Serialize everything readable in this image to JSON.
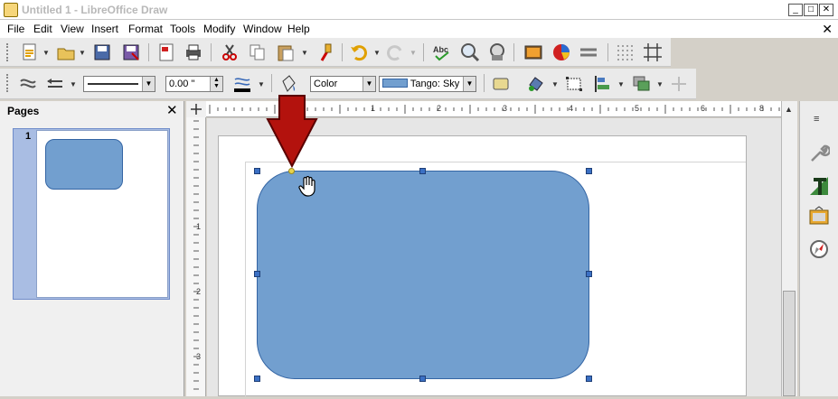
{
  "window": {
    "title": "Untitled 1 - LibreOffice Draw",
    "minimize": "_",
    "maximize": "□",
    "close": "✕",
    "doc_close": "✕"
  },
  "menu": [
    "File",
    "Edit",
    "View",
    "Insert",
    "Format",
    "Tools",
    "Modify",
    "Window",
    "Help"
  ],
  "toolbar2": {
    "line_width": "0.00 \"",
    "area_style": "Color",
    "fill_color": "Tango: Sky"
  },
  "pages_panel": {
    "title": "Pages",
    "close": "✕",
    "page_number": "1"
  },
  "ruler": {
    "h_ticks": [
      "1",
      "2",
      "3",
      "4",
      "5",
      "6",
      "7",
      "8"
    ],
    "v_ticks": [
      "1",
      "2",
      "3"
    ]
  },
  "colors": {
    "shape_fill": "#729fcf",
    "shape_border": "#3465a4",
    "arrow": "#b3120d"
  }
}
